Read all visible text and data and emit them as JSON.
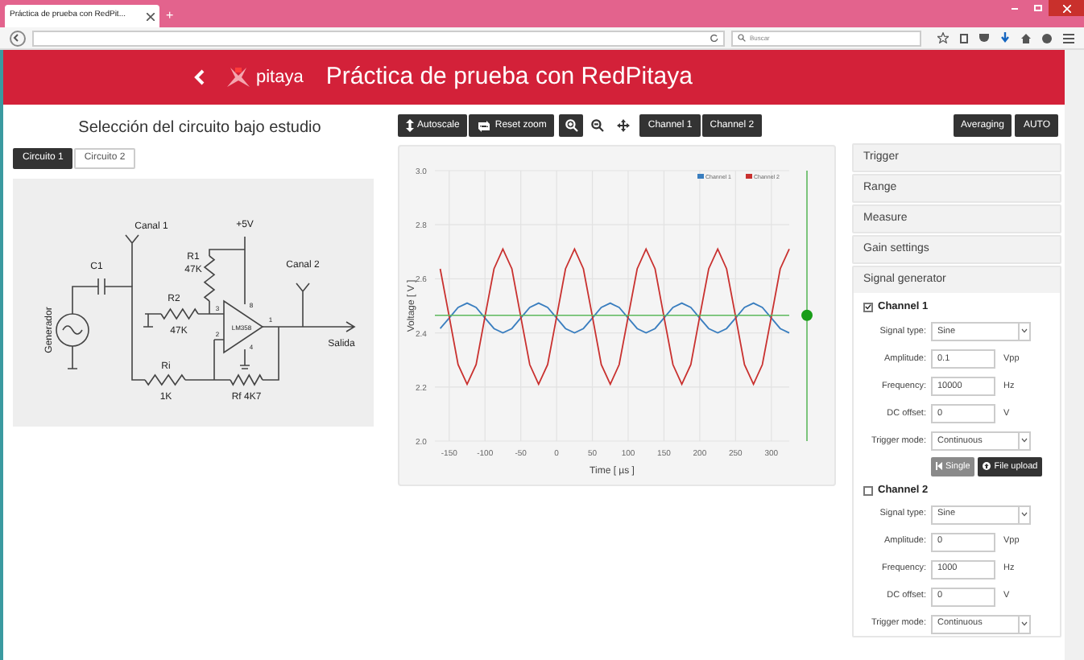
{
  "browser": {
    "tab_title": "Práctica de prueba con RedPit...",
    "new_tab": "+",
    "search_placeholder": "Buscar"
  },
  "header": {
    "logo_text": "pitaya",
    "title": "Práctica de prueba con RedPitaya"
  },
  "circuit_panel": {
    "title": "Selección del circuito bajo estudio",
    "tabs": [
      {
        "label": "Circuito 1",
        "selected": true
      },
      {
        "label": "Circuito 2",
        "selected": false
      }
    ],
    "labels": [
      "+5V",
      "Canal 1",
      "R1",
      "C1",
      "Canal 2",
      "47K",
      "R2",
      "8",
      "3",
      "1",
      "Generador",
      "LM358",
      "47K",
      "2",
      "Salida",
      "4",
      "Ri",
      "1K",
      "Rf  4K7"
    ]
  },
  "toolbar": [
    {
      "kind": "button",
      "label": "Autoscale",
      "selected": true
    },
    {
      "kind": "button",
      "label": "Reset zoom",
      "selected": true
    },
    {
      "kind": "tool",
      "selected": true
    },
    {
      "kind": "tool",
      "selected": false
    },
    {
      "kind": "tool",
      "selected": false
    },
    {
      "kind": "button",
      "label": "Channel 1",
      "selected": true
    },
    {
      "kind": "button",
      "label": "Channel 2",
      "selected": true
    }
  ],
  "chart_data": {
    "type": "line",
    "xlabel": "Time [ µs ]",
    "ylabel": "Voltage [ V ]",
    "x": [
      -162.5,
      -150,
      -137.5,
      -125,
      -112.5,
      -100,
      -87.5,
      -75,
      -62.5,
      -50,
      -37.5,
      -25,
      -12.5,
      0,
      12.5,
      25,
      37.5,
      50,
      62.5,
      75,
      87.5,
      100,
      112.5,
      125,
      137.5,
      150,
      162.5,
      175,
      187.5,
      200,
      212.5,
      225,
      237.5,
      250,
      262.5,
      275,
      287.5,
      300,
      312.5,
      325
    ],
    "series": [
      {
        "name": "Channel 1",
        "color": "#3a7ebf",
        "values": [
          2.416,
          2.455,
          2.494,
          2.51,
          2.494,
          2.455,
          2.416,
          2.4,
          2.416,
          2.455,
          2.494,
          2.51,
          2.494,
          2.455,
          2.416,
          2.4,
          2.416,
          2.455,
          2.494,
          2.51,
          2.494,
          2.455,
          2.416,
          2.4,
          2.416,
          2.455,
          2.494,
          2.51,
          2.494,
          2.455,
          2.416,
          2.4,
          2.416,
          2.455,
          2.494,
          2.51,
          2.494,
          2.455,
          2.416,
          2.4
        ]
      },
      {
        "name": "Channel 2",
        "color": "#c9312f",
        "values": [
          2.637,
          2.46,
          2.283,
          2.21,
          2.283,
          2.46,
          2.637,
          2.71,
          2.637,
          2.46,
          2.283,
          2.21,
          2.283,
          2.46,
          2.637,
          2.71,
          2.637,
          2.46,
          2.283,
          2.21,
          2.283,
          2.46,
          2.637,
          2.71,
          2.637,
          2.46,
          2.283,
          2.21,
          2.283,
          2.46,
          2.637,
          2.71,
          2.637,
          2.46,
          2.283,
          2.21,
          2.283,
          2.46,
          2.637,
          2.71
        ]
      }
    ],
    "xlim": [
      -170,
      325
    ],
    "ylim": [
      2.0,
      3.0
    ],
    "xticks": [
      -150,
      -100,
      -50,
      0,
      50,
      100,
      150,
      200,
      250,
      300
    ],
    "yticks": [
      {
        "value": 2.0,
        "label": "2.0"
      },
      {
        "value": 2.2,
        "label": "2.2"
      },
      {
        "value": 2.4,
        "label": "2.4"
      },
      {
        "value": 2.6,
        "label": "2.6"
      },
      {
        "value": 2.8,
        "label": "2.8"
      },
      {
        "value": 3.0,
        "label": "3.0"
      }
    ],
    "grid": true,
    "legend": true,
    "ref_lines": [
      {
        "axis": "y",
        "value": 2.465,
        "color": "#5cb85c"
      }
    ]
  },
  "top_buttons": [
    "Averaging",
    "AUTO"
  ],
  "accordion": [
    {
      "label": "Trigger",
      "expanded": false
    },
    {
      "label": "Range",
      "expanded": false
    },
    {
      "label": "Measure",
      "expanded": false
    },
    {
      "label": "Gain settings",
      "expanded": false
    },
    {
      "label": "Signal generator",
      "expanded": true
    }
  ],
  "generator_channels": [
    {
      "name": "Channel 1",
      "checked": true,
      "fields": [
        {
          "kind": "select",
          "label": "Signal type:",
          "value": "Sine"
        },
        {
          "kind": "input",
          "label": "Amplitude:",
          "value": "0.1",
          "unit": "Vpp"
        },
        {
          "kind": "input",
          "label": "Frequency:",
          "value": "10000",
          "unit": "Hz"
        },
        {
          "kind": "input",
          "label": "DC offset:",
          "value": "0",
          "unit": "V"
        },
        {
          "kind": "select",
          "label": "Trigger mode:",
          "value": "Continuous"
        }
      ],
      "buttons": [
        {
          "label": "Single",
          "disabled": true
        },
        {
          "label": "File upload",
          "disabled": false
        }
      ]
    },
    {
      "name": "Channel 2",
      "checked": false,
      "fields": [
        {
          "kind": "select",
          "label": "Signal type:",
          "value": "Sine"
        },
        {
          "kind": "input",
          "label": "Amplitude:",
          "value": "0",
          "unit": "Vpp"
        },
        {
          "kind": "input",
          "label": "Frequency:",
          "value": "1000",
          "unit": "Hz"
        },
        {
          "kind": "input",
          "label": "DC offset:",
          "value": "0",
          "unit": "V"
        },
        {
          "kind": "select",
          "label": "Trigger mode:",
          "value": "Continuous"
        }
      ]
    }
  ]
}
